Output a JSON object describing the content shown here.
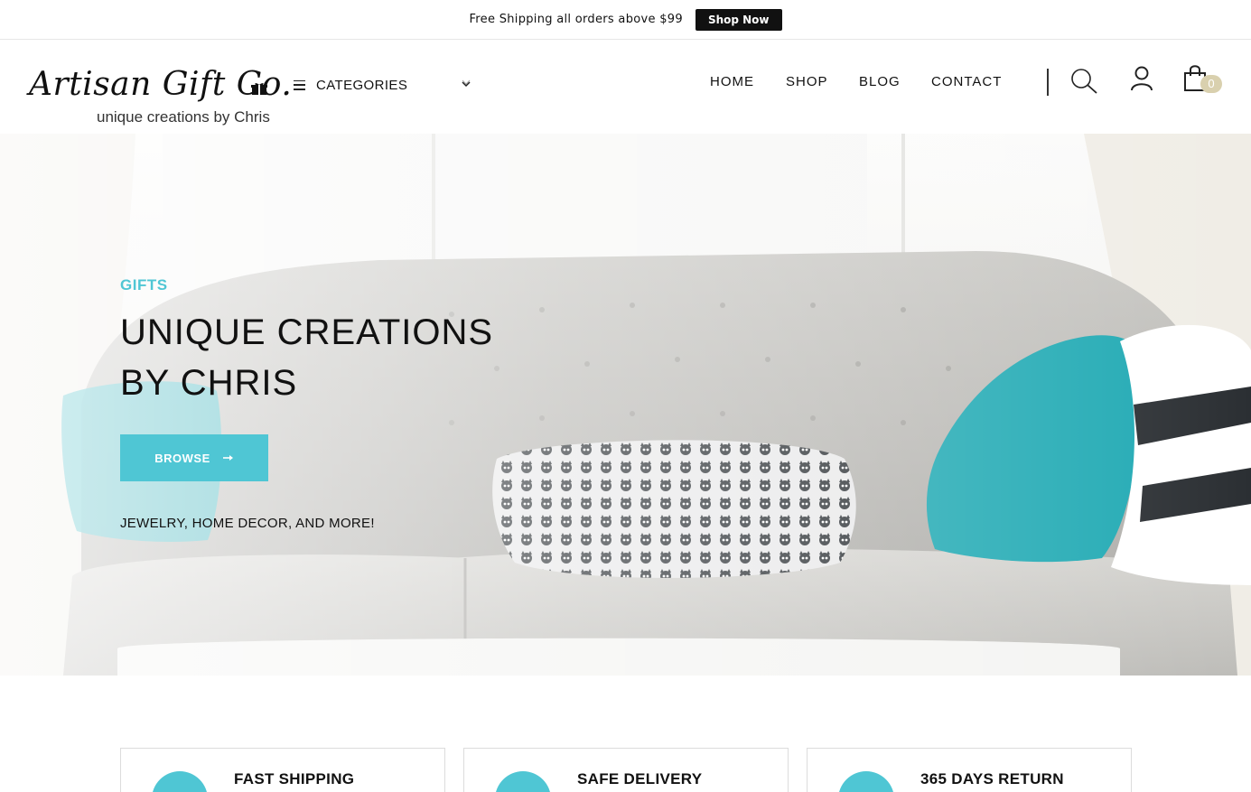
{
  "topbar": {
    "text": "Free Shipping all orders above $99",
    "button": "Shop Now"
  },
  "logo": {
    "main": "Artisan Gift Co.",
    "sub": "unique creations by Chris"
  },
  "categories": {
    "label": "CATEGORIES"
  },
  "nav": {
    "items": [
      "HOME",
      "SHOP",
      "BLOG",
      "CONTACT"
    ]
  },
  "header_icons": [
    "search-icon",
    "user-icon",
    "cart-icon"
  ],
  "cart": {
    "count": "0"
  },
  "hero": {
    "eyebrow": "GIFTS",
    "title_line1": "UNIQUE CREATIONS",
    "title_line2": "BY CHRIS",
    "button": "BROWSE",
    "subtitle": "JEWELRY, HOME DECOR, AND MORE!"
  },
  "features": [
    {
      "title": "FAST SHIPPING"
    },
    {
      "title": "SAFE DELIVERY"
    },
    {
      "title": "365 DAYS RETURN"
    }
  ],
  "colors": {
    "accent": "#4fc6d4",
    "badge": "#d9d0ae",
    "text": "#111111"
  }
}
